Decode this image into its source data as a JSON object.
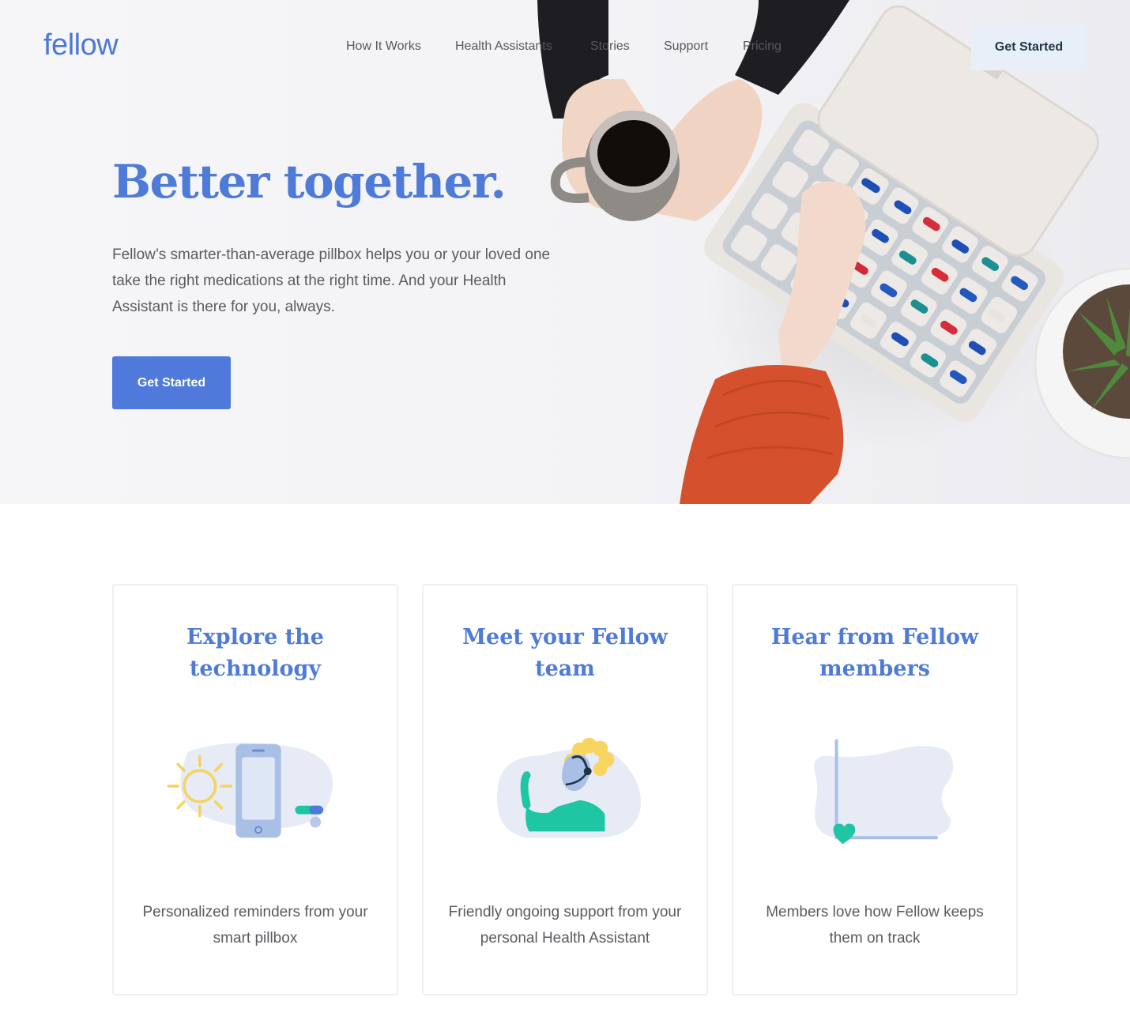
{
  "brand": {
    "logo": "fellow"
  },
  "nav": {
    "links": [
      "How It Works",
      "Health Assistants",
      "Stories",
      "Support",
      "Pricing"
    ],
    "cta_label": "Get Started"
  },
  "hero": {
    "title": "Better together.",
    "description": "Fellow’s smarter-than-average pillbox helps you or your loved one take the right medications at the right time. And your Health Assistant is there for you, always.",
    "cta_label": "Get Started"
  },
  "features": [
    {
      "title": "Explore the technology",
      "description": "Personalized reminders from your smart pillbox",
      "icon": "phone-sun-pills-icon"
    },
    {
      "title": "Meet your Fellow team",
      "description": "Friendly ongoing support from your personal Health Assistant",
      "icon": "health-assistant-icon"
    },
    {
      "title": "Hear from Fellow members",
      "description": "Members love how Fellow keeps them on track",
      "icon": "heart-chart-icon"
    }
  ],
  "colors": {
    "brand": "#4e7ad8",
    "button": "#4f7adb",
    "nav_cta_bg": "#e9eff8",
    "accent_teal": "#1fc6a4",
    "accent_yellow": "#f7d560"
  }
}
